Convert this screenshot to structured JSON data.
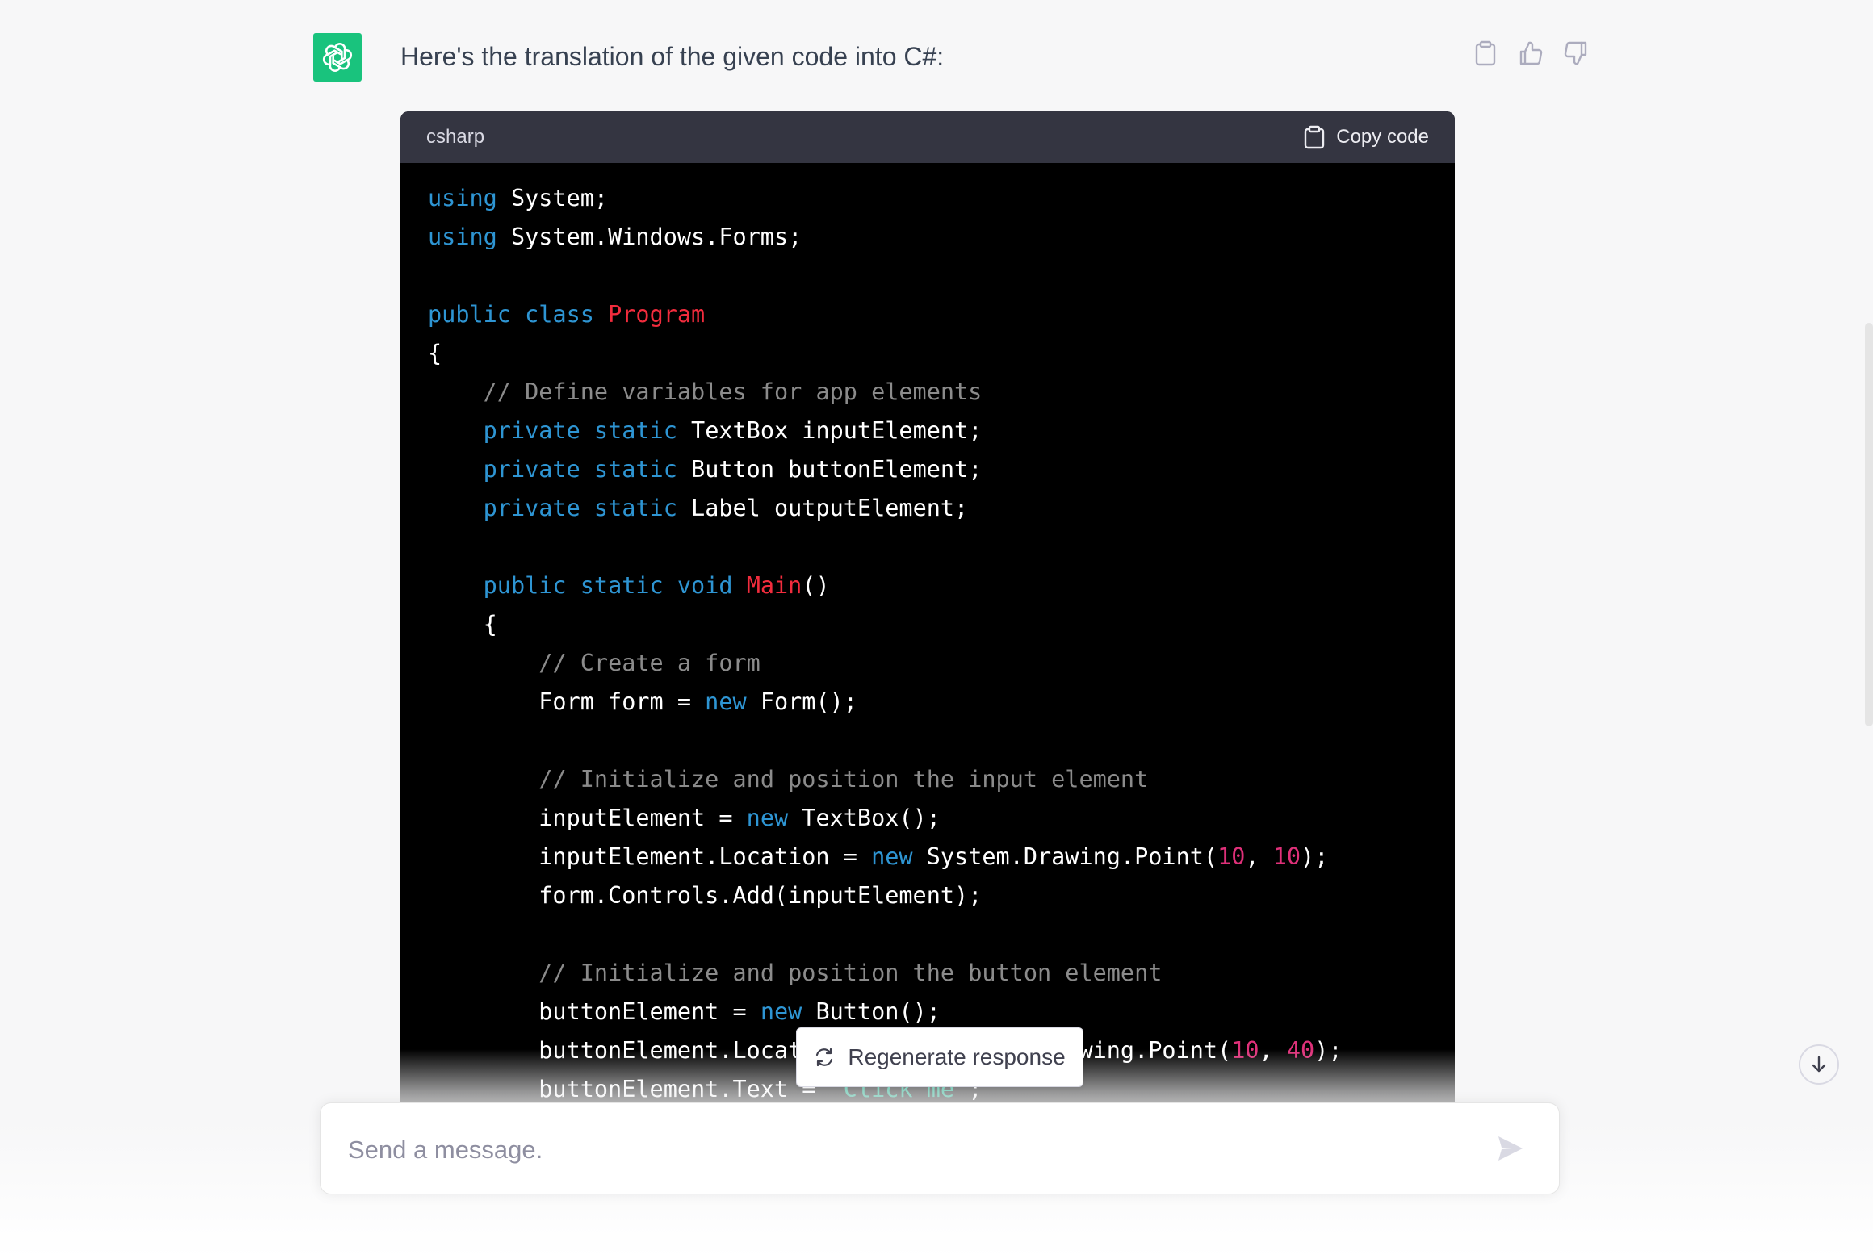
{
  "message": {
    "intro_text": "Here's the translation of the given code into C#:"
  },
  "code_block": {
    "language": "csharp",
    "copy_label": "Copy code",
    "lines": [
      [
        [
          "kw",
          "using"
        ],
        [
          "t",
          " System;"
        ]
      ],
      [
        [
          "kw",
          "using"
        ],
        [
          "t",
          " System.Windows.Forms;"
        ]
      ],
      [],
      [
        [
          "kw",
          "public"
        ],
        [
          "t",
          " "
        ],
        [
          "kw",
          "class"
        ],
        [
          "t",
          " "
        ],
        [
          "cls",
          "Program"
        ]
      ],
      [
        [
          "t",
          "{"
        ]
      ],
      [
        [
          "t",
          "    "
        ],
        [
          "cm",
          "// Define variables for app elements"
        ]
      ],
      [
        [
          "t",
          "    "
        ],
        [
          "kw",
          "private"
        ],
        [
          "t",
          " "
        ],
        [
          "kw",
          "static"
        ],
        [
          "t",
          " TextBox inputElement;"
        ]
      ],
      [
        [
          "t",
          "    "
        ],
        [
          "kw",
          "private"
        ],
        [
          "t",
          " "
        ],
        [
          "kw",
          "static"
        ],
        [
          "t",
          " Button buttonElement;"
        ]
      ],
      [
        [
          "t",
          "    "
        ],
        [
          "kw",
          "private"
        ],
        [
          "t",
          " "
        ],
        [
          "kw",
          "static"
        ],
        [
          "t",
          " Label outputElement;"
        ]
      ],
      [],
      [
        [
          "t",
          "    "
        ],
        [
          "kw",
          "public"
        ],
        [
          "t",
          " "
        ],
        [
          "kw",
          "static"
        ],
        [
          "t",
          " "
        ],
        [
          "kw",
          "void"
        ],
        [
          "t",
          " "
        ],
        [
          "cls",
          "Main"
        ],
        [
          "t",
          "()"
        ]
      ],
      [
        [
          "t",
          "    {"
        ]
      ],
      [
        [
          "t",
          "        "
        ],
        [
          "cm",
          "// Create a form"
        ]
      ],
      [
        [
          "t",
          "        Form form = "
        ],
        [
          "kw",
          "new"
        ],
        [
          "t",
          " Form();"
        ]
      ],
      [],
      [
        [
          "t",
          "        "
        ],
        [
          "cm",
          "// Initialize and position the input element"
        ]
      ],
      [
        [
          "t",
          "        inputElement = "
        ],
        [
          "kw",
          "new"
        ],
        [
          "t",
          " TextBox();"
        ]
      ],
      [
        [
          "t",
          "        inputElement.Location = "
        ],
        [
          "kw",
          "new"
        ],
        [
          "t",
          " System.Drawing.Point("
        ],
        [
          "num",
          "10"
        ],
        [
          "t",
          ", "
        ],
        [
          "num",
          "10"
        ],
        [
          "t",
          ");"
        ]
      ],
      [
        [
          "t",
          "        form.Controls.Add(inputElement);"
        ]
      ],
      [],
      [
        [
          "t",
          "        "
        ],
        [
          "cm",
          "// Initialize and position the button element"
        ]
      ],
      [
        [
          "t",
          "        buttonElement = "
        ],
        [
          "kw",
          "new"
        ],
        [
          "t",
          " Button();"
        ]
      ],
      [
        [
          "t",
          "        buttonElement.Location = "
        ],
        [
          "kw",
          "new"
        ],
        [
          "t",
          " System.Drawing.Point("
        ],
        [
          "num",
          "10"
        ],
        [
          "t",
          ", "
        ],
        [
          "num",
          "40"
        ],
        [
          "t",
          ");"
        ]
      ],
      [
        [
          "t",
          "        buttonElement.Text = "
        ],
        [
          "str",
          "\"Click me\""
        ],
        [
          "t",
          ";"
        ]
      ]
    ]
  },
  "regenerate": {
    "label": "Regenerate response"
  },
  "composer": {
    "placeholder": "Send a message."
  },
  "icons": {
    "avatar": "openai-logo-icon",
    "clipboard": "clipboard-icon",
    "thumbs_up": "thumbs-up-icon",
    "thumbs_down": "thumbs-down-icon",
    "refresh": "refresh-icon",
    "send": "send-icon",
    "scroll_down": "arrow-down-icon"
  },
  "colors": {
    "avatar_bg": "#19c37d",
    "keyword": "#2e95d3",
    "class_name": "#f22c3d",
    "comment": "#8b8b8b",
    "number": "#df3079",
    "string": "#00a67d",
    "code_bg": "#000000",
    "code_header_bg": "#343541"
  }
}
